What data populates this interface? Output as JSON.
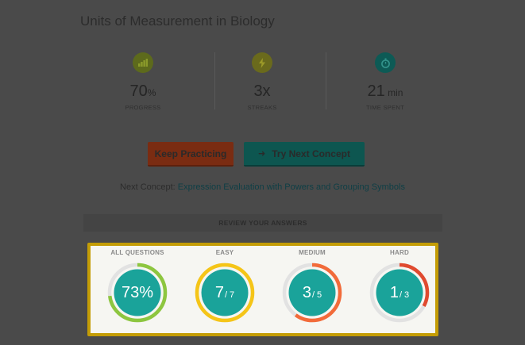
{
  "title": "Units of Measurement in Biology",
  "stats": [
    {
      "value": "70",
      "unit": "%",
      "label": "PROGRESS",
      "icon": "bar-chart-icon",
      "color": "#6c7a1e"
    },
    {
      "value": "3x",
      "unit": "",
      "label": "STREAKS",
      "icon": "lightning-icon",
      "color": "#7a7a1a"
    },
    {
      "value": "21",
      "unit": " min",
      "label": "TIME SPENT",
      "icon": "stopwatch-icon",
      "color": "#0f5a55"
    }
  ],
  "buttons": {
    "keep_practicing": "Keep Practicing",
    "try_next": "Try Next Concept"
  },
  "next_concept": {
    "prefix": "Next Concept:",
    "link": "Expression Evaluation with Powers and Grouping Symbols"
  },
  "review_header": "REVIEW YOUR ANSWERS",
  "review": {
    "all": {
      "label": "ALL QUESTIONS",
      "value": "73%",
      "fraction": 0.73,
      "color": "#8dc63f"
    },
    "easy": {
      "label": "EASY",
      "correct": "7",
      "total": "/ 7",
      "fraction": 1.0,
      "color": "#f5c518"
    },
    "medium": {
      "label": "MEDIUM",
      "correct": "3",
      "total": "/ 5",
      "fraction": 0.6,
      "color": "#f26b3a"
    },
    "hard": {
      "label": "HARD",
      "correct": "1",
      "total": "/ 3",
      "fraction": 0.33,
      "color": "#e04a2f"
    }
  },
  "colors": {
    "ring_fill": "#1aa39a",
    "ring_track": "#e2e2e2",
    "panel_border": "#c49d06"
  }
}
